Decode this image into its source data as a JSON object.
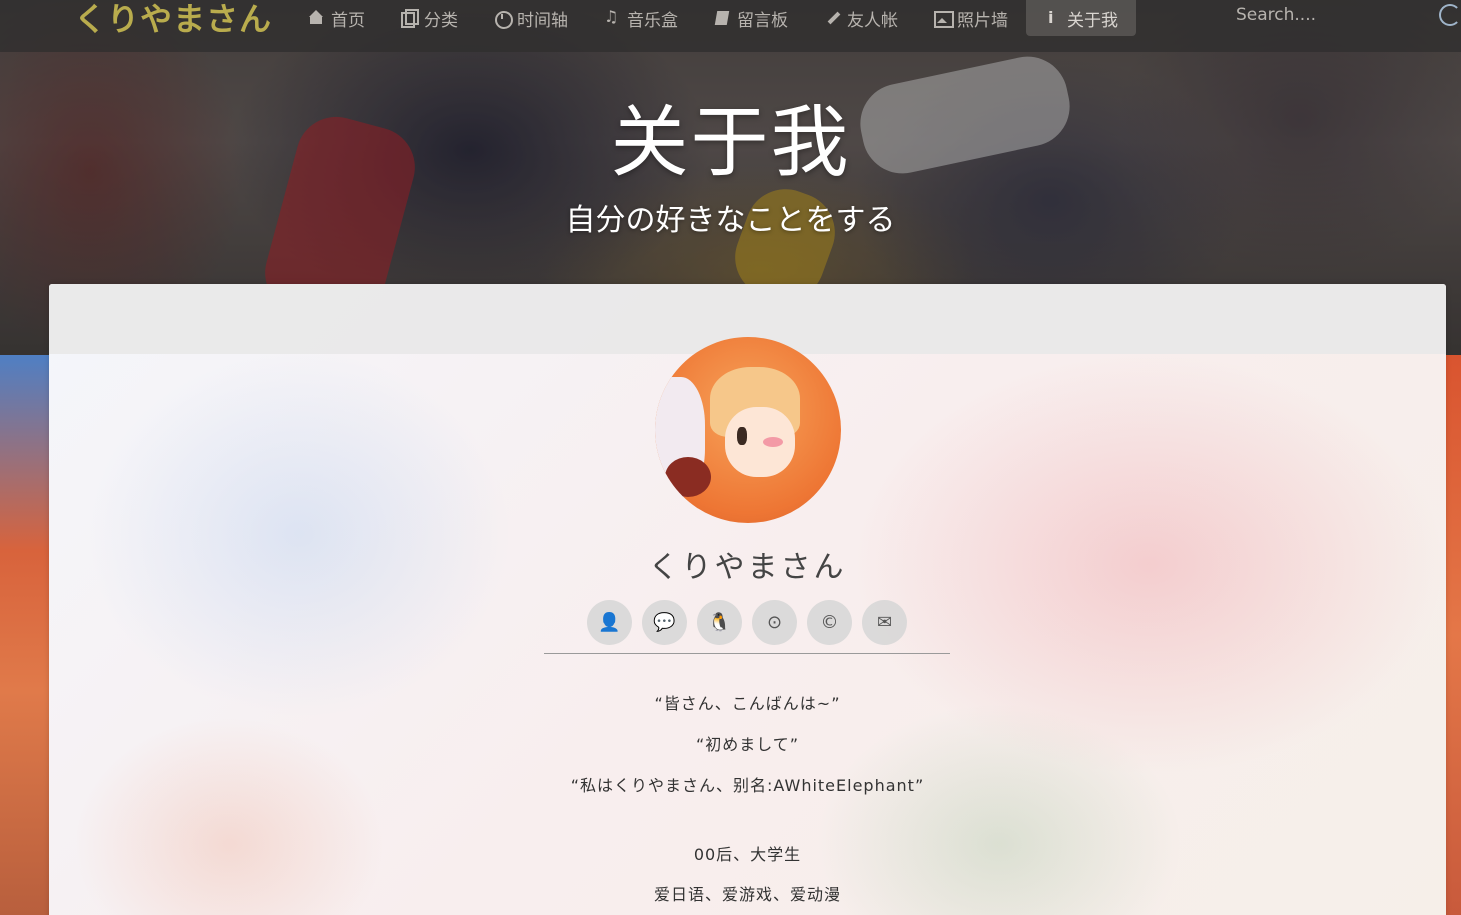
{
  "nav": {
    "brand": "くりやまさん",
    "items": [
      {
        "label": "首页",
        "icon": "home-icon"
      },
      {
        "label": "分类",
        "icon": "copy-icon"
      },
      {
        "label": "时间轴",
        "icon": "clock-icon"
      },
      {
        "label": "音乐盒",
        "icon": "music-icon"
      },
      {
        "label": "留言板",
        "icon": "book-icon"
      },
      {
        "label": "友人帐",
        "icon": "pencil-icon"
      },
      {
        "label": "照片墙",
        "icon": "image-icon"
      },
      {
        "label": "关于我",
        "icon": "info-icon",
        "active": true
      }
    ],
    "search_placeholder": "Search...."
  },
  "hero": {
    "title": "关于我",
    "subtitle": "自分の好きなことをする"
  },
  "profile": {
    "name": "くりやまさん",
    "socials": [
      {
        "icon": "user-icon",
        "glyph": "👤"
      },
      {
        "icon": "wechat-icon",
        "glyph": "💬"
      },
      {
        "icon": "qq-icon",
        "glyph": "🐧"
      },
      {
        "icon": "github-icon",
        "glyph": "⊙"
      },
      {
        "icon": "copyright-icon",
        "glyph": "©"
      },
      {
        "icon": "mail-icon",
        "glyph": "✉"
      }
    ],
    "bio": [
      "“皆さん、こんばんは~”",
      "“初めまして”",
      "“私はくりやまさん、别名:AWhiteElephant”",
      "00后、大学生",
      "爱日语、爱游戏、爱动漫"
    ]
  },
  "colors": {
    "brand": "#b9ac4d",
    "nav_bg": "#302e2e",
    "nav_text": "#b7b3ae"
  }
}
